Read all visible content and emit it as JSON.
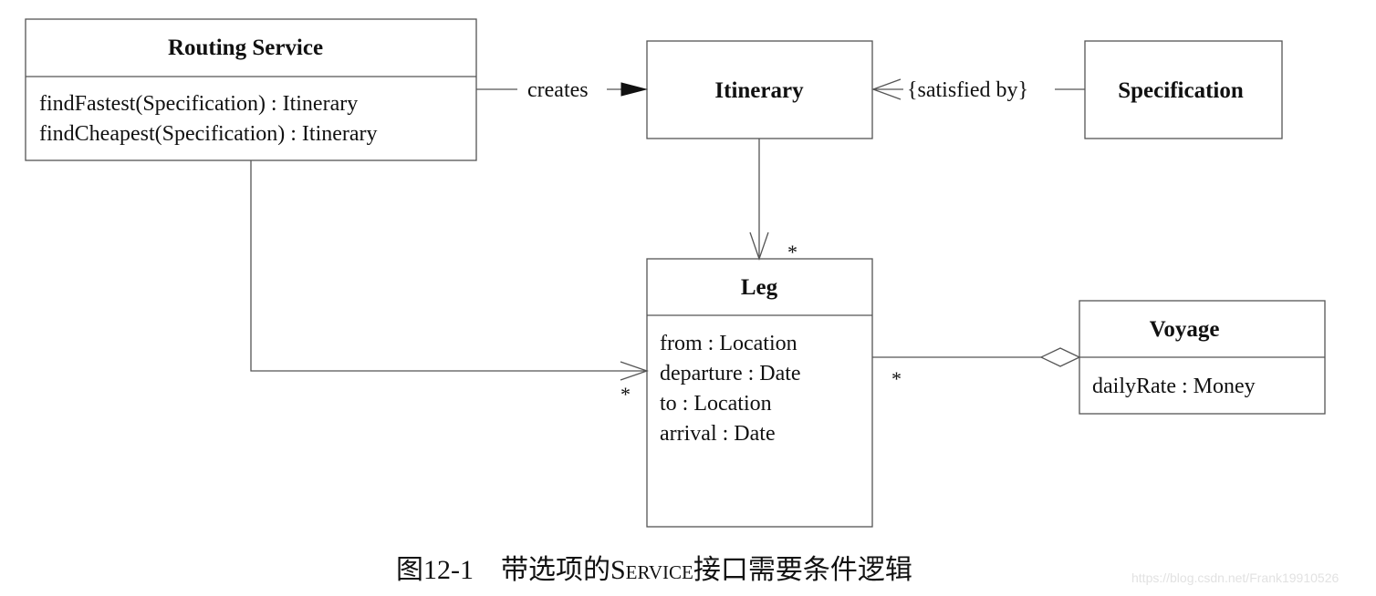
{
  "diagram": {
    "classes": {
      "routing_service": {
        "name": "Routing Service",
        "operations": [
          "findFastest(Specification) : Itinerary",
          "findCheapest(Specification) : Itinerary"
        ]
      },
      "itinerary": {
        "name": "Itinerary"
      },
      "specification": {
        "name": "Specification"
      },
      "leg": {
        "name": "Leg",
        "attributes": [
          "from : Location",
          "departure : Date",
          "to : Location",
          "arrival : Date"
        ]
      },
      "voyage": {
        "name": "Voyage",
        "attributes": [
          "dailyRate : Money"
        ]
      }
    },
    "relationships": {
      "creates": {
        "label": "creates",
        "from": "Routing Service",
        "to": "Itinerary",
        "arrow": "filled-triangle"
      },
      "satisfied_by": {
        "label": "{satisfied by}",
        "from": "Specification",
        "to": "Itinerary",
        "arrow": "open-arrow"
      },
      "itinerary_leg": {
        "from": "Itinerary",
        "to": "Leg",
        "arrow": "open-arrow",
        "multiplicity": "*"
      },
      "routing_leg": {
        "from": "Routing Service",
        "to": "Leg",
        "arrow": "open-arrow",
        "multiplicity": "*"
      },
      "leg_voyage": {
        "from": "Leg",
        "to": "Voyage",
        "arrow": "hollow-diamond",
        "multiplicity": "*"
      }
    }
  },
  "caption": {
    "figure_number": "图12-1",
    "text_before": "带选项的",
    "text_smallcaps": "Service",
    "text_after": "接口需要条件逻辑"
  },
  "watermark": "https://blog.csdn.net/Frank19910526"
}
